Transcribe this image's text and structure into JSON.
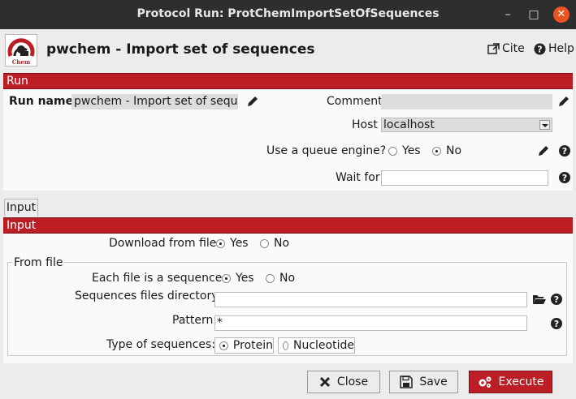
{
  "window": {
    "title": "Protocol Run: ProtChemImportSetOfSequences"
  },
  "header": {
    "logo_text": "Chem",
    "title": "pwchem - Import set of sequences",
    "cite_label": "Cite",
    "help_label": "Help"
  },
  "run_section": {
    "title": "Run",
    "run_name_label": "Run name",
    "run_name_value": "pwchem - Import set of sequences",
    "comment_label": "Comment",
    "comment_value": "",
    "host_label": "Host",
    "host_value": "localhost",
    "queue_label": "Use a queue engine?",
    "queue_yes": "Yes",
    "queue_no": "No",
    "queue_selected": "No",
    "wait_label": "Wait for",
    "wait_value": ""
  },
  "tabs": [
    {
      "label": "Input"
    }
  ],
  "input_section": {
    "title": "Input",
    "download_label": "Download from file",
    "download_yes": "Yes",
    "download_no": "No",
    "download_selected": "Yes",
    "group_title": "From file",
    "each_file_label": "Each file is a sequence",
    "each_file_yes": "Yes",
    "each_file_no": "No",
    "each_file_selected": "Yes",
    "dir_label": "Sequences files directory:",
    "dir_value": "",
    "pattern_label": "Pattern",
    "pattern_value": "*",
    "type_label": "Type of sequences:",
    "type_protein": "Protein",
    "type_nucleotide": "Nucleotide",
    "type_selected": "Protein"
  },
  "footer": {
    "close_label": "Close",
    "save_label": "Save",
    "execute_label": "Execute"
  },
  "colors": {
    "accent": "#bb1e24",
    "titlebar": "#2e2e2e",
    "close_circle": "#e95420"
  }
}
